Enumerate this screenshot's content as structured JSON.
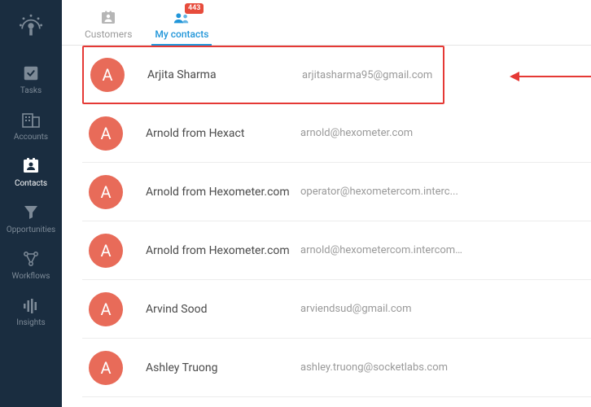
{
  "sidebar": {
    "items": [
      {
        "label": "Tasks"
      },
      {
        "label": "Accounts"
      },
      {
        "label": "Contacts"
      },
      {
        "label": "Opportunities"
      },
      {
        "label": "Workflows"
      },
      {
        "label": "Insights"
      }
    ]
  },
  "tabs": {
    "customers": {
      "label": "Customers"
    },
    "my_contacts": {
      "label": "My contacts",
      "badge": "443"
    }
  },
  "contacts": [
    {
      "initial": "A",
      "name": "Arjita Sharma",
      "email": "arjitasharma95@gmail.com"
    },
    {
      "initial": "A",
      "name": "Arnold from Hexact",
      "email": "arnold@hexometer.com"
    },
    {
      "initial": "A",
      "name": "Arnold from Hexometer.com",
      "email": "operator@hexometercom.interc..."
    },
    {
      "initial": "A",
      "name": "Arnold from Hexometer.com",
      "email": "arnold@hexometercom.intercom..."
    },
    {
      "initial": "A",
      "name": "Arvind Sood",
      "email": "arviendsud@gmail.com"
    },
    {
      "initial": "A",
      "name": "Ashley Truong",
      "email": "ashley.truong@socketlabs.com"
    }
  ]
}
